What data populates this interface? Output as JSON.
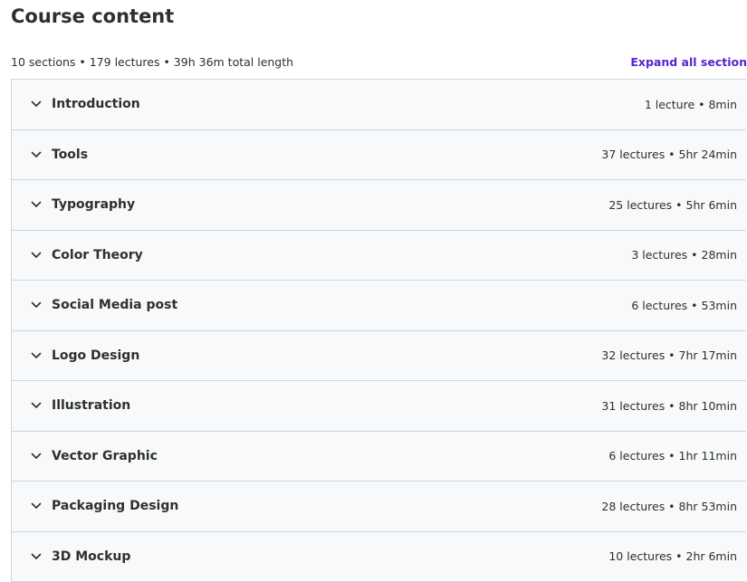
{
  "header": {
    "title": "Course content",
    "summary": "10 sections • 179 lectures • 39h 36m total length",
    "expand_all_label": "Expand all section"
  },
  "colors": {
    "accent": "#5624d0",
    "row_background": "#f7f9fa",
    "border": "#d1d7dc",
    "text": "#2d2f31"
  },
  "sections": [
    {
      "title": "Introduction",
      "meta": "1 lecture • 8min",
      "icon": "chevron-down-icon"
    },
    {
      "title": "Tools",
      "meta": "37 lectures • 5hr 24min",
      "icon": "chevron-down-icon"
    },
    {
      "title": "Typography",
      "meta": "25 lectures • 5hr 6min",
      "icon": "chevron-down-icon"
    },
    {
      "title": "Color Theory",
      "meta": "3 lectures • 28min",
      "icon": "chevron-down-icon"
    },
    {
      "title": "Social Media post",
      "meta": "6 lectures • 53min",
      "icon": "chevron-down-icon"
    },
    {
      "title": "Logo Design",
      "meta": "32 lectures • 7hr 17min",
      "icon": "chevron-down-icon"
    },
    {
      "title": "Illustration",
      "meta": "31 lectures • 8hr 10min",
      "icon": "chevron-down-icon"
    },
    {
      "title": "Vector Graphic",
      "meta": "6 lectures • 1hr 11min",
      "icon": "chevron-down-icon"
    },
    {
      "title": "Packaging Design",
      "meta": "28 lectures • 8hr 53min",
      "icon": "chevron-down-icon"
    },
    {
      "title": "3D Mockup",
      "meta": "10 lectures • 2hr 6min",
      "icon": "chevron-down-icon"
    }
  ]
}
